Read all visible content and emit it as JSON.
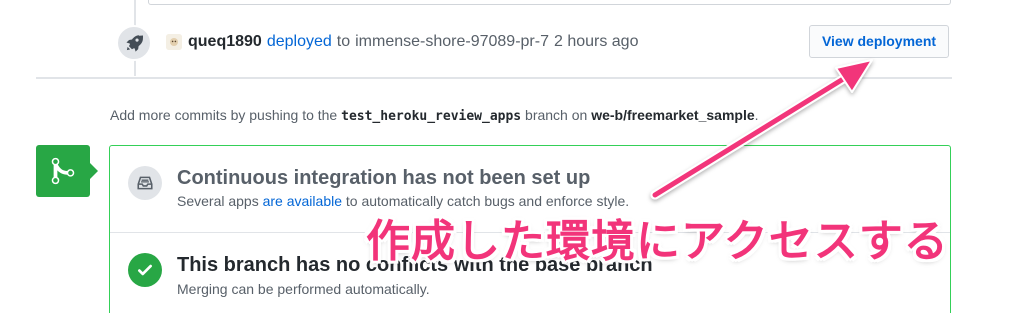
{
  "deployment": {
    "actor": "queq1890",
    "action": "deployed",
    "to_word": "to",
    "target": "immense-shore-97089-pr-7",
    "time": "2 hours ago",
    "button_label": "View deployment"
  },
  "push_hint": {
    "prefix": "Add more commits by pushing to the",
    "branch": "test_heroku_review_apps",
    "middle": "branch on",
    "repo": "we-b/freemarket_sample",
    "suffix": "."
  },
  "ci": {
    "title": "Continuous integration has not been set up",
    "sub_prefix": "Several apps",
    "sub_link": "are available",
    "sub_suffix": "to automatically catch bugs and enforce style."
  },
  "merge_status": {
    "title": "This branch has no conflicts with the base branch",
    "subtitle": "Merging can be performed automatically."
  },
  "annotation": {
    "text": "作成した環境にアクセスする"
  },
  "colors": {
    "accent_link": "#0366d6",
    "success_green": "#28a745",
    "annotation_pink": "#f2347a"
  }
}
